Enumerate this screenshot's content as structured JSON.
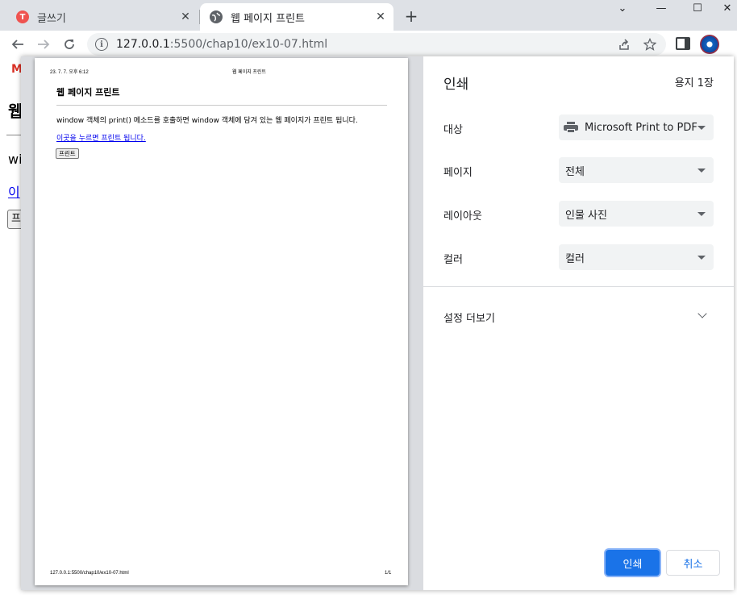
{
  "browser": {
    "tabs": [
      {
        "title": "글쓰기",
        "favicon": "tistory-icon",
        "active": false
      },
      {
        "title": "웹 페이지 프린트",
        "favicon": "globe-icon",
        "active": true
      }
    ],
    "new_tab_symbol": "+",
    "window_controls": {
      "minimize": "⌄",
      "restore": "—",
      "maximize": "☐",
      "close": "✕"
    },
    "address": {
      "host": "127.0.0.1",
      "path": ":5500/chap10/ex10-07.html"
    }
  },
  "page_behind": {
    "bookmark_glyph": "M",
    "heading": "웹",
    "text": "wi",
    "link": "이",
    "button": "프"
  },
  "print_dialog": {
    "title": "인쇄",
    "sheet_count": "용지 1장",
    "settings": [
      {
        "label": "대상",
        "value": "Microsoft Print to PDF",
        "icon": "printer-icon"
      },
      {
        "label": "페이지",
        "value": "전체"
      },
      {
        "label": "레이아웃",
        "value": "인물 사진"
      },
      {
        "label": "컬러",
        "value": "컬러"
      }
    ],
    "more_settings": "설정 더보기",
    "print_button": "인쇄",
    "cancel_button": "취소",
    "colors": {
      "accent": "#1a73e8"
    }
  },
  "preview": {
    "header_date": "23. 7. 7. 오후 6:12",
    "header_title": "웹 페이지 프린트",
    "doc_title": "웹 페이지 프린트",
    "doc_text": "window 객체의 print() 메소드를 호출하면 window 객체에 담겨 있는 웹 페이지가 프린트 됩니다.",
    "doc_link": "이곳을 누르면 프린트 됩니다.",
    "doc_button": "프린트",
    "footer_url": "127.0.0.1:5500/chap10/ex10-07.html",
    "footer_page": "1/1"
  }
}
